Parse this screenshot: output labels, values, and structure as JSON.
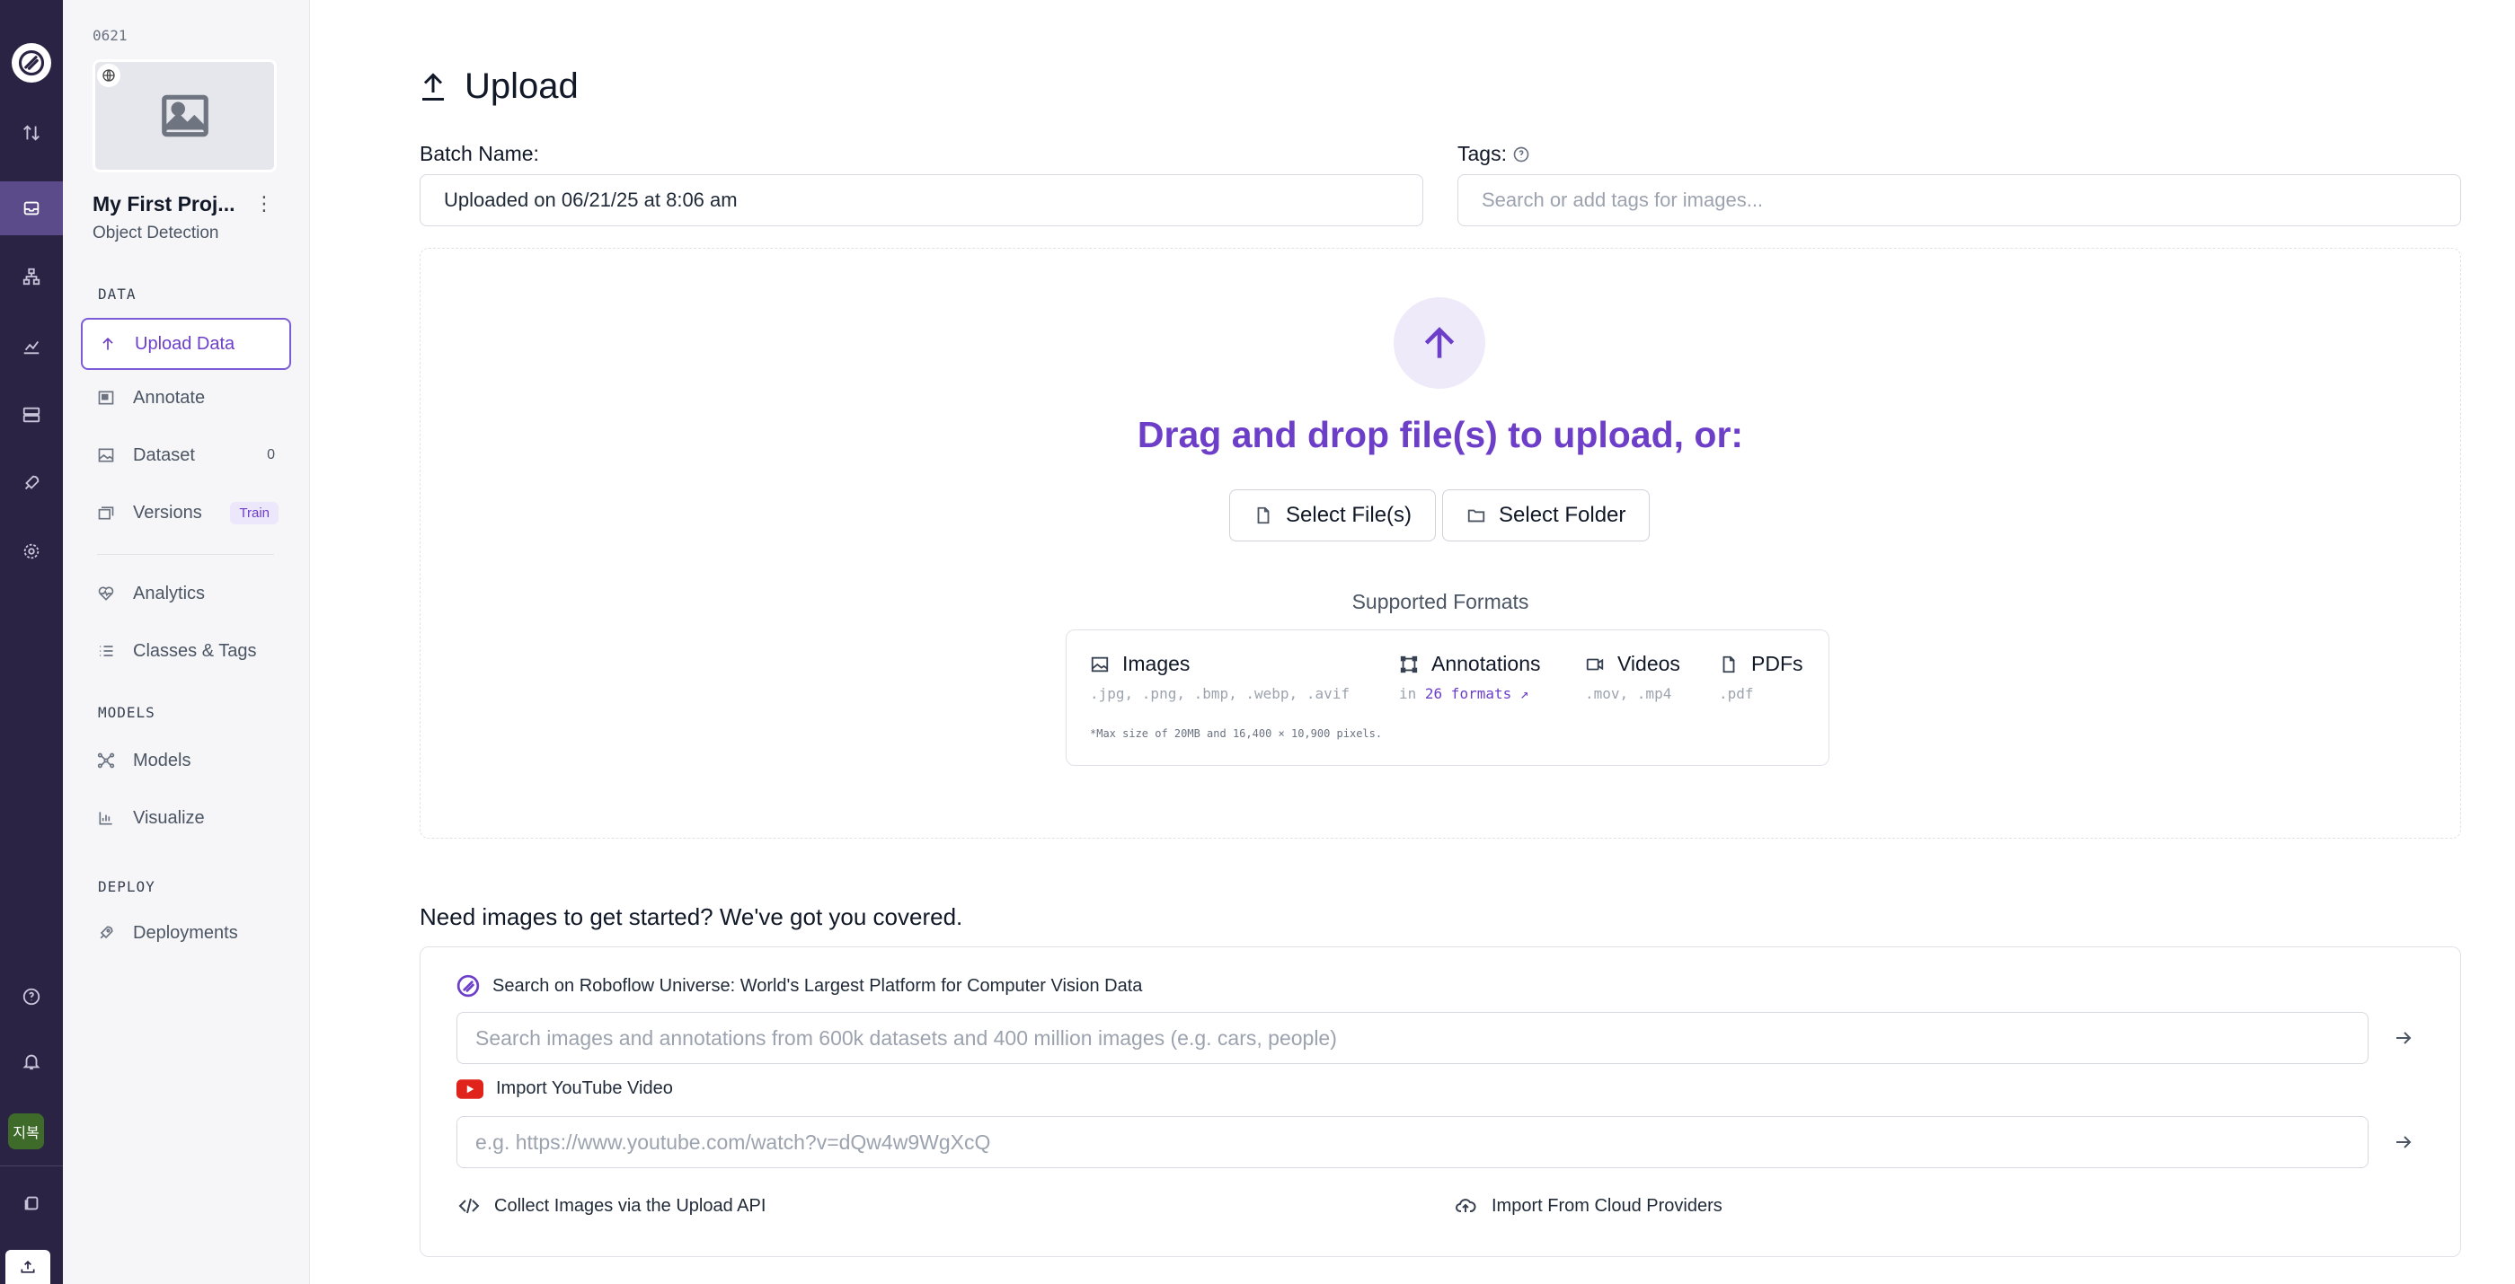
{
  "rail": {
    "logo": "roboflow-logo",
    "avatar_text": "지복"
  },
  "project": {
    "id": "0621",
    "name": "My First Proj...",
    "type": "Object Detection"
  },
  "sidebar": {
    "sections": {
      "data": "DATA",
      "models": "MODELS",
      "deploy": "DEPLOY"
    },
    "items": [
      {
        "label": "Upload Data",
        "icon": "arrow-up-icon"
      },
      {
        "label": "Annotate",
        "icon": "annotate-icon"
      },
      {
        "label": "Dataset",
        "icon": "image-icon",
        "count": "0"
      },
      {
        "label": "Versions",
        "icon": "versions-icon",
        "badge": "Train"
      },
      {
        "label": "Analytics",
        "icon": "heart-pulse-icon"
      },
      {
        "label": "Classes & Tags",
        "icon": "list-icon"
      },
      {
        "label": "Models",
        "icon": "models-icon"
      },
      {
        "label": "Visualize",
        "icon": "chart-icon"
      },
      {
        "label": "Deployments",
        "icon": "rocket-icon"
      }
    ]
  },
  "page": {
    "title": "Upload",
    "batch_label": "Batch Name:",
    "batch_value": "Uploaded on 06/21/25 at 8:06 am",
    "tags_label": "Tags:",
    "tags_placeholder": "Search or add tags for images..."
  },
  "dropzone": {
    "headline": "Drag and drop file(s) to upload, or:",
    "select_files": "Select File(s)",
    "select_folder": "Select Folder",
    "supported_title": "Supported Formats",
    "formats": {
      "images": {
        "label": "Images",
        "ext": ".jpg, .png, .bmp, .webp, .avif"
      },
      "annotations": {
        "label": "Annotations",
        "prefix": "in",
        "link": "26 formats"
      },
      "videos": {
        "label": "Videos",
        "ext": ".mov, .mp4"
      },
      "pdfs": {
        "label": "PDFs",
        "ext": ".pdf"
      }
    },
    "note": "*Max size of 20MB and 16,400 × 10,900 pixels."
  },
  "getting_started": {
    "title": "Need images to get started? We've got you covered.",
    "universe_label": "Search on Roboflow Universe: World's Largest Platform for Computer Vision Data",
    "universe_placeholder": "Search images and annotations from 600k datasets and 400 million images (e.g. cars, people)",
    "youtube_label": "Import YouTube Video",
    "youtube_placeholder": "e.g. https://www.youtube.com/watch?v=dQw4w9WgXcQ",
    "api_label": "Collect Images via the Upload API",
    "cloud_label": "Import From Cloud Providers"
  },
  "colors": {
    "accent": "#6d3fc9",
    "rail_bg": "#2a2344",
    "rail_active": "#5b4b8a",
    "youtube_red": "#e0231b"
  }
}
